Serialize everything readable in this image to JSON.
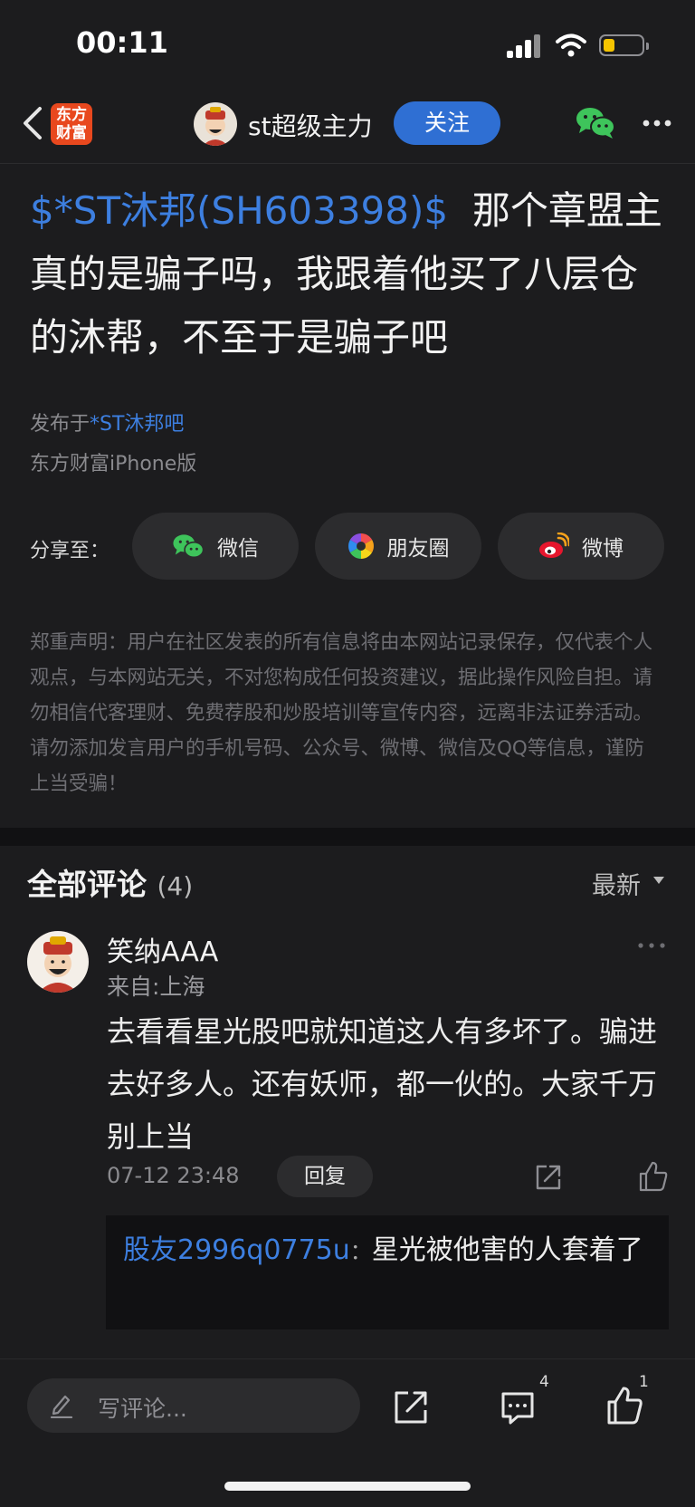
{
  "status_bar": {
    "time": "00:11"
  },
  "header": {
    "brand_logo_text": "东方财富",
    "author_name": "st超级主力",
    "follow_label": "关注"
  },
  "post": {
    "stock_tag": "$*ST沐邦(SH603398)$",
    "title": "那个章盟主真的是骗子吗，我跟着他买了八层仓的沐帮，不至于是骗子吧",
    "published_prefix": "发布于",
    "published_board": "*ST沐邦吧",
    "client": "东方财富iPhone版"
  },
  "share": {
    "label": "分享至：",
    "buttons": [
      {
        "label": "微信",
        "icon": "wechat-icon"
      },
      {
        "label": "朋友圈",
        "icon": "moments-icon"
      },
      {
        "label": "微博",
        "icon": "weibo-icon"
      }
    ]
  },
  "disclaimer": "郑重声明：用户在社区发表的所有信息将由本网站记录保存，仅代表个人观点，与本网站无关，不对您构成任何投资建议，据此操作风险自担。请勿相信代客理财、免费荐股和炒股培训等宣传内容，远离非法证券活动。请勿添加发言用户的手机号码、公众号、微博、微信及QQ等信息，谨防上当受骗！",
  "comments": {
    "title": "全部评论",
    "count": "(4)",
    "sort_label": "最新",
    "items": [
      {
        "user": "笑纳AAA",
        "location": "来自:上海",
        "text": "去看看星光股吧就知道这人有多坏了。骗进去好多人。还有妖师，都一伙的。大家千万别上当",
        "time": "07-12 23:48",
        "reply_label": "回复",
        "replies": [
          {
            "user": "股友2996q0775u",
            "separator": "：",
            "text": "星光被他害的人套着了"
          }
        ]
      }
    ]
  },
  "bottom_bar": {
    "input_placeholder": "写评论...",
    "comment_count": "4",
    "like_count": "1"
  },
  "colors": {
    "background": "#1c1c1e",
    "accent_blue": "#3d7fe0",
    "follow_button": "#2f6fd3",
    "brand_orange": "#e8481e",
    "wechat_green": "#3ec45b"
  }
}
